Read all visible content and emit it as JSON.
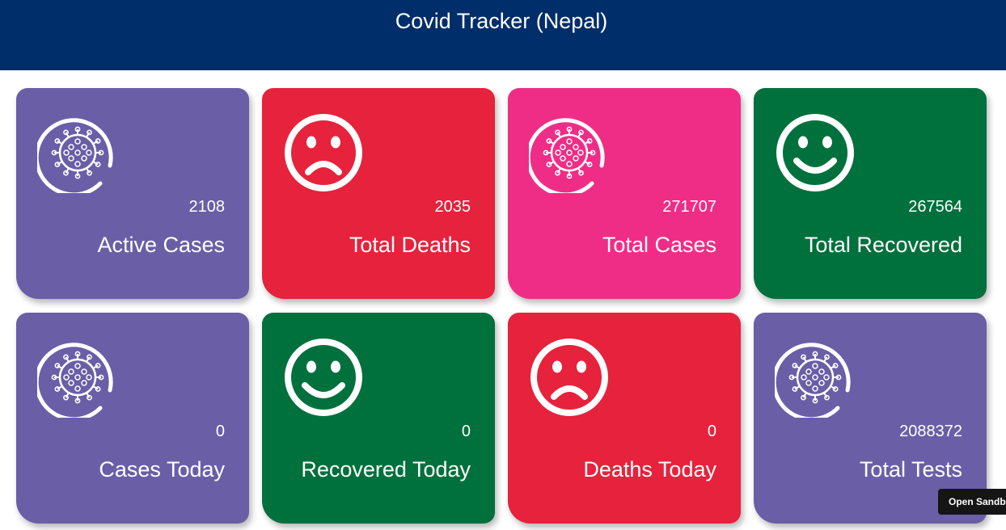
{
  "header": {
    "title": "Covid Tracker (Nepal)"
  },
  "colors": {
    "header_bg": "#002e6a",
    "purple": "#6a5ea7",
    "red": "#e6223c",
    "pink": "#ef2d86",
    "green": "#00703c"
  },
  "cards": [
    {
      "value": "2108",
      "label": "Active Cases",
      "icon": "virus-icon",
      "color": "#6a5ea7"
    },
    {
      "value": "2035",
      "label": "Total Deaths",
      "icon": "sad-face-icon",
      "color": "#e6223c"
    },
    {
      "value": "271707",
      "label": "Total Cases",
      "icon": "virus-icon",
      "color": "#ef2d86"
    },
    {
      "value": "267564",
      "label": "Total Recovered",
      "icon": "happy-face-icon",
      "color": "#00703c"
    },
    {
      "value": "0",
      "label": "Cases Today",
      "icon": "virus-icon",
      "color": "#6a5ea7"
    },
    {
      "value": "0",
      "label": "Recovered Today",
      "icon": "happy-face-icon",
      "color": "#00703c"
    },
    {
      "value": "0",
      "label": "Deaths Today",
      "icon": "sad-face-icon",
      "color": "#e6223c"
    },
    {
      "value": "2088372",
      "label": "Total Tests",
      "icon": "virus-icon",
      "color": "#6a5ea7"
    }
  ],
  "sandbox_button": {
    "label": "Open Sandbox"
  }
}
